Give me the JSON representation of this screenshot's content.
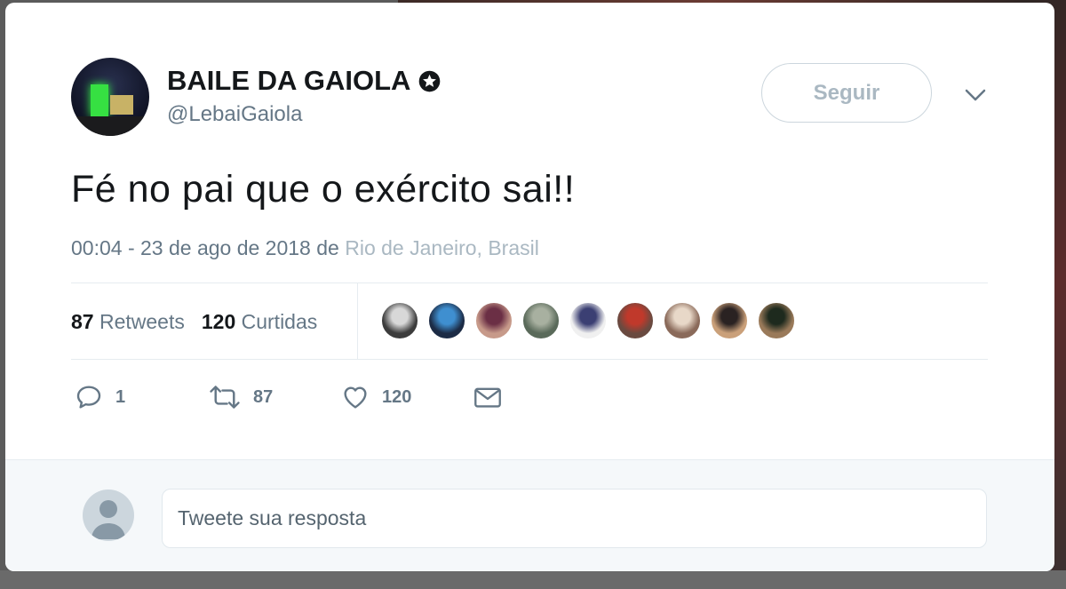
{
  "author": {
    "name": "BAILE DA GAIOLA",
    "handle": "@LebaiGaiola",
    "verified_icon": "verified-badge-icon"
  },
  "header": {
    "follow_label": "Seguir",
    "menu_icon": "chevron-down-icon"
  },
  "tweet": {
    "text": "Fé no pai que o exército sai!!",
    "time_date": "00:04 - 23 de ago de 2018",
    "from_word": "de",
    "location": "Rio de Janeiro, Brasil"
  },
  "stats": {
    "retweets_count": "87",
    "retweets_label": "Retweets",
    "likes_count": "120",
    "likes_label": "Curtidas"
  },
  "likers": [
    {
      "color": "#3c3c3c",
      "accent": "#d8d8d8"
    },
    {
      "color": "#1c2b45",
      "accent": "#3f8fd0"
    },
    {
      "color": "#c79a8a",
      "accent": "#6b2f45"
    },
    {
      "color": "#5a6a5a",
      "accent": "#a8b0a0"
    },
    {
      "color": "#f0f0f0",
      "accent": "#3b3f73"
    },
    {
      "color": "#6a4a40",
      "accent": "#c0392b"
    },
    {
      "color": "#8a6a5a",
      "accent": "#e8d8c8"
    },
    {
      "color": "#caa07a",
      "accent": "#2a2222"
    },
    {
      "color": "#9a7a5a",
      "accent": "#1e2a1e"
    }
  ],
  "actions": {
    "reply_count": "1",
    "retweet_count": "87",
    "like_count": "120"
  },
  "reply": {
    "placeholder": "Tweete sua resposta"
  },
  "colors": {
    "text_primary": "#14171a",
    "text_secondary": "#657786",
    "border": "#e6ecf0",
    "reply_bg": "#f5f8fa"
  }
}
